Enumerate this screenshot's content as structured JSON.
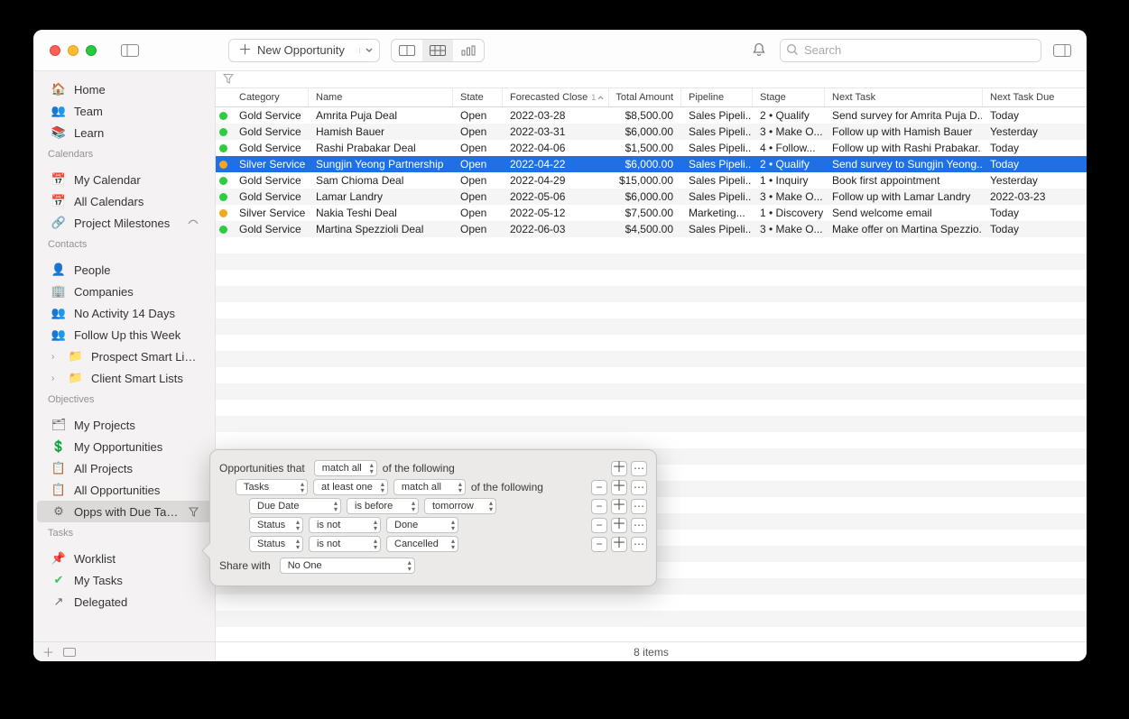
{
  "toolbar": {
    "new_opportunity": "New Opportunity",
    "search_placeholder": "Search"
  },
  "sidebar": {
    "top": [
      "Home",
      "Team",
      "Learn"
    ],
    "calendars_head": "Calendars",
    "calendars": [
      "My Calendar",
      "All Calendars",
      "Project Milestones"
    ],
    "contacts_head": "Contacts",
    "contacts": [
      "People",
      "Companies",
      "No Activity 14 Days",
      "Follow Up this Week",
      "Prospect Smart Lists",
      "Client Smart Lists"
    ],
    "objectives_head": "Objectives",
    "objectives": [
      "My Projects",
      "My Opportunities",
      "All Projects",
      "All Opportunities",
      "Opps with Due Tasks"
    ],
    "tasks_head": "Tasks",
    "tasks": [
      "Worklist",
      "My Tasks",
      "Delegated"
    ]
  },
  "columns": {
    "category": "Category",
    "name": "Name",
    "state": "State",
    "fc": "Forecasted Close",
    "sort_num": "1",
    "amount": "Total Amount",
    "pipeline": "Pipeline",
    "stage": "Stage",
    "task": "Next Task",
    "due": "Next Task Due"
  },
  "rows": [
    {
      "dot": "green",
      "cat": "Gold Service",
      "name": "Amrita Puja Deal",
      "state": "Open",
      "fc": "2022-03-28",
      "amt": "$8,500.00",
      "pipe": "Sales Pipeli...",
      "stage": "2 • Qualify",
      "task": "Send survey for Amrita Puja D...",
      "due": "Today",
      "sel": false
    },
    {
      "dot": "green",
      "cat": "Gold Service",
      "name": "Hamish Bauer",
      "state": "Open",
      "fc": "2022-03-31",
      "amt": "$6,000.00",
      "pipe": "Sales Pipeli...",
      "stage": "3 • Make O...",
      "task": "Follow up with Hamish Bauer",
      "due": "Yesterday",
      "sel": false
    },
    {
      "dot": "green",
      "cat": "Gold Service",
      "name": "Rashi Prabakar Deal",
      "state": "Open",
      "fc": "2022-04-06",
      "amt": "$1,500.00",
      "pipe": "Sales Pipeli...",
      "stage": "4 • Follow...",
      "task": "Follow up with Rashi Prabakar...",
      "due": "Today",
      "sel": false
    },
    {
      "dot": "orange",
      "cat": "Silver Service",
      "name": "Sungjin Yeong Partnership",
      "state": "Open",
      "fc": "2022-04-22",
      "amt": "$6,000.00",
      "pipe": "Sales Pipeli...",
      "stage": "2 • Qualify",
      "task": "Send survey to Sungjin Yeong...",
      "due": "Today",
      "sel": true
    },
    {
      "dot": "green",
      "cat": "Gold Service",
      "name": "Sam Chioma Deal",
      "state": "Open",
      "fc": "2022-04-29",
      "amt": "$15,000.00",
      "pipe": "Sales Pipeli...",
      "stage": "1 • Inquiry",
      "task": "Book first appointment",
      "due": "Yesterday",
      "sel": false
    },
    {
      "dot": "green",
      "cat": "Gold Service",
      "name": "Lamar Landry",
      "state": "Open",
      "fc": "2022-05-06",
      "amt": "$6,000.00",
      "pipe": "Sales Pipeli...",
      "stage": "3 • Make O...",
      "task": "Follow up with Lamar Landry",
      "due": "2022-03-23",
      "sel": false
    },
    {
      "dot": "orange",
      "cat": "Silver Service",
      "name": "Nakia Teshi Deal",
      "state": "Open",
      "fc": "2022-05-12",
      "amt": "$7,500.00",
      "pipe": "Marketing...",
      "stage": "1 • Discovery",
      "task": "Send welcome email",
      "due": "Today",
      "sel": false
    },
    {
      "dot": "green",
      "cat": "Gold Service",
      "name": "Martina Spezzioli Deal",
      "state": "Open",
      "fc": "2022-06-03",
      "amt": "$4,500.00",
      "pipe": "Sales Pipeli...",
      "stage": "3 • Make O...",
      "task": "Make offer on Martina Spezzio...",
      "due": "Today",
      "sel": false
    }
  ],
  "footer": {
    "count": "8 items"
  },
  "popover": {
    "opps_that": "Opportunities that",
    "match_all": "match all",
    "of_following": "of the following",
    "tasks": "Tasks",
    "at_least_one": "at least one",
    "due_date": "Due Date",
    "is_before": "is before",
    "tomorrow": "tomorrow",
    "status": "Status",
    "is_not": "is not",
    "done": "Done",
    "cancelled": "Cancelled",
    "share_with": "Share with",
    "no_one": "No One"
  }
}
